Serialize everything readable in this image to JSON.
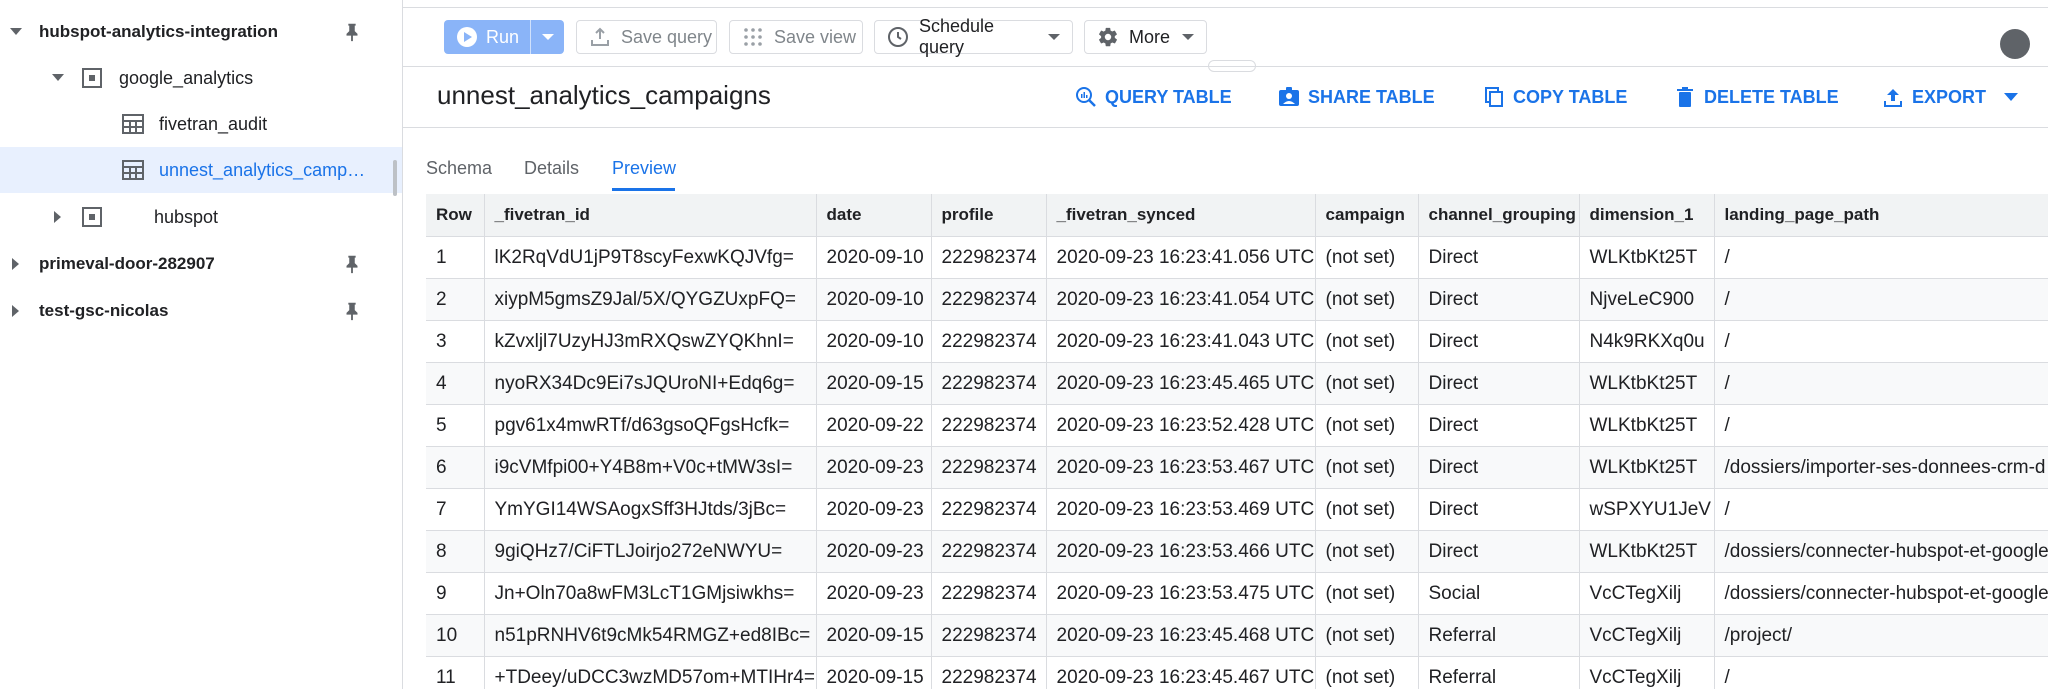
{
  "sidebar": {
    "projects": [
      {
        "name": "hubspot-analytics-integration",
        "expanded": true
      },
      {
        "name": "primeval-door-282907",
        "expanded": false
      },
      {
        "name": "test-gsc-nicolas",
        "expanded": false
      }
    ],
    "datasets": [
      {
        "name": "google_analytics",
        "expanded": true
      },
      {
        "name": "hubspot",
        "expanded": false
      }
    ],
    "tables": [
      {
        "name": "fivetran_audit"
      },
      {
        "name": "unnest_analytics_campai…",
        "selected": true
      }
    ]
  },
  "toolbar": {
    "run_label": "Run",
    "save_query_label": "Save query",
    "save_view_label": "Save view",
    "schedule_query_label": "Schedule query",
    "more_label": "More"
  },
  "table_header": {
    "title": "unnest_analytics_campaigns",
    "actions": {
      "query": "QUERY TABLE",
      "share": "SHARE TABLE",
      "copy": "COPY TABLE",
      "delete": "DELETE TABLE",
      "export": "EXPORT"
    }
  },
  "tabs": [
    {
      "label": "Schema"
    },
    {
      "label": "Details"
    },
    {
      "label": "Preview",
      "active": true
    }
  ],
  "preview_table": {
    "columns": [
      "Row",
      "_fivetran_id",
      "date",
      "profile",
      "_fivetran_synced",
      "campaign",
      "channel_grouping",
      "dimension_1",
      "landing_page_path"
    ],
    "rows": [
      [
        "1",
        "lK2RqVdU1jP9T8scyFexwKQJVfg=",
        "2020-09-10",
        "222982374",
        "2020-09-23 16:23:41.056 UTC",
        "(not set)",
        "Direct",
        "WLKtbKt25T",
        "/"
      ],
      [
        "2",
        "xiypM5gmsZ9Jal/5X/QYGZUxpFQ=",
        "2020-09-10",
        "222982374",
        "2020-09-23 16:23:41.054 UTC",
        "(not set)",
        "Direct",
        "NjveLeC900",
        "/"
      ],
      [
        "3",
        "kZvxljl7UzyHJ3mRXQswZYQKhnI=",
        "2020-09-10",
        "222982374",
        "2020-09-23 16:23:41.043 UTC",
        "(not set)",
        "Direct",
        "N4k9RKXq0u",
        "/"
      ],
      [
        "4",
        "nyoRX34Dc9Ei7sJQUroNI+Edq6g=",
        "2020-09-15",
        "222982374",
        "2020-09-23 16:23:45.465 UTC",
        "(not set)",
        "Direct",
        "WLKtbKt25T",
        "/"
      ],
      [
        "5",
        "pgv61x4mwRTf/d63gsoQFgsHcfk=",
        "2020-09-22",
        "222982374",
        "2020-09-23 16:23:52.428 UTC",
        "(not set)",
        "Direct",
        "WLKtbKt25T",
        "/"
      ],
      [
        "6",
        "i9cVMfpi00+Y4B8m+V0c+tMW3sI=",
        "2020-09-23",
        "222982374",
        "2020-09-23 16:23:53.467 UTC",
        "(not set)",
        "Direct",
        "WLKtbKt25T",
        "/dossiers/importer-ses-donnees-crm-d"
      ],
      [
        "7",
        "YmYGI14WSAogxSff3HJtds/3jBc=",
        "2020-09-23",
        "222982374",
        "2020-09-23 16:23:53.469 UTC",
        "(not set)",
        "Direct",
        "wSPXYU1JeV",
        "/"
      ],
      [
        "8",
        "9giQHz7/CiFTLJoirjo272eNWYU=",
        "2020-09-23",
        "222982374",
        "2020-09-23 16:23:53.466 UTC",
        "(not set)",
        "Direct",
        "WLKtbKt25T",
        "/dossiers/connecter-hubspot-et-google"
      ],
      [
        "9",
        "Jn+Oln70a8wFM3LcT1GMjsiwkhs=",
        "2020-09-23",
        "222982374",
        "2020-09-23 16:23:53.475 UTC",
        "(not set)",
        "Social",
        "VcCTegXilj",
        "/dossiers/connecter-hubspot-et-google"
      ],
      [
        "10",
        "n51pRNHV6t9cMk54RMGZ+ed8IBc=",
        "2020-09-15",
        "222982374",
        "2020-09-23 16:23:45.468 UTC",
        "(not set)",
        "Referral",
        "VcCTegXilj",
        "/project/"
      ],
      [
        "11",
        "+TDeey/uDCC3wzMD57om+MTIHr4=",
        "2020-09-15",
        "222982374",
        "2020-09-23 16:23:45.467 UTC",
        "(not set)",
        "Referral",
        "VcCTegXilj",
        "/"
      ]
    ]
  },
  "colors": {
    "accent": "#1a73e8",
    "run_button": "#8ab4f8",
    "selected_row": "#e8f0fe"
  }
}
